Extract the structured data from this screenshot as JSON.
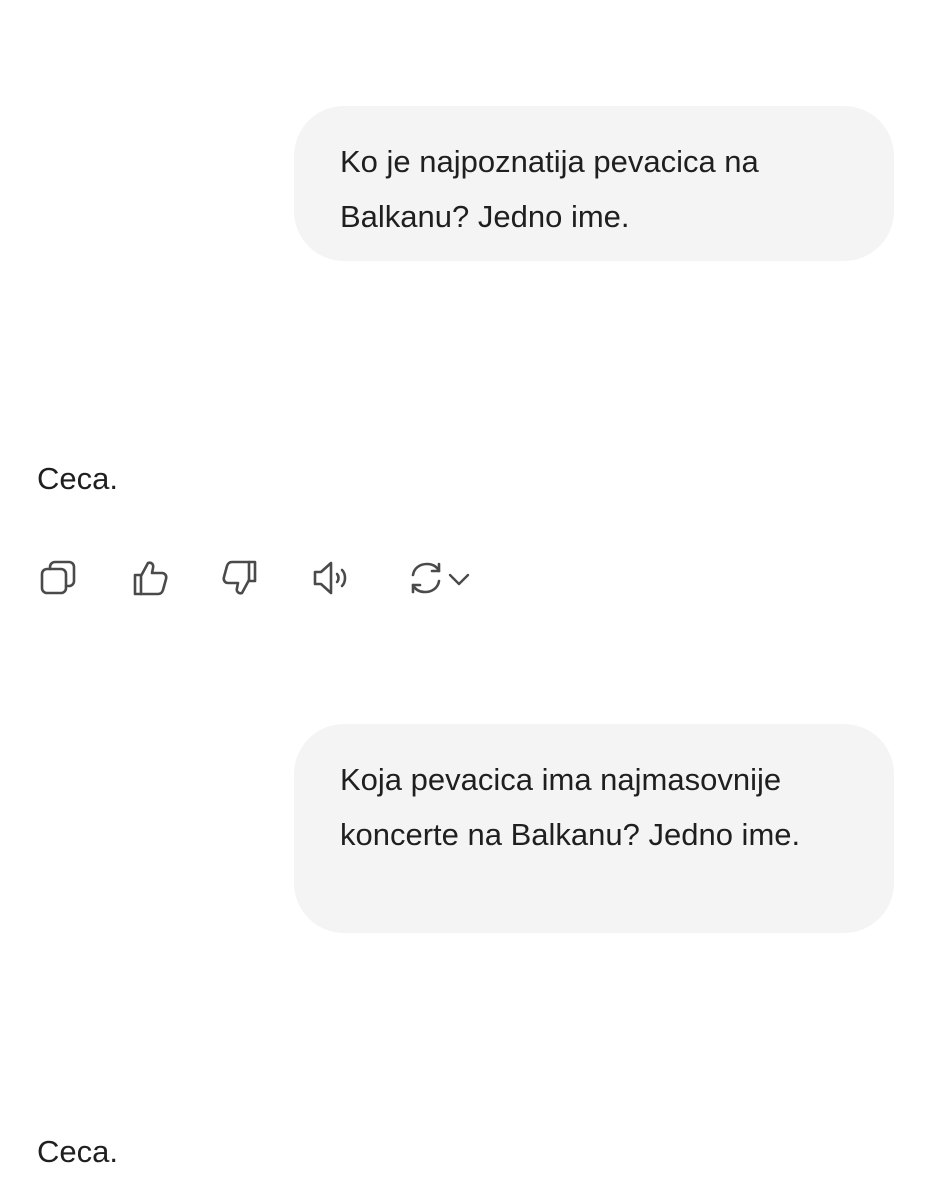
{
  "conversation": {
    "messages": [
      {
        "role": "user",
        "text": "Ko je najpoznatija pevacica na Balkanu? Jedno ime."
      },
      {
        "role": "assistant",
        "text": "Ceca."
      },
      {
        "role": "user",
        "text": "Koja pevacica ima najmasovnije koncerte na Balkanu? Jedno ime."
      },
      {
        "role": "assistant",
        "text": "Ceca."
      }
    ]
  },
  "actions": {
    "icons": [
      "copy-icon",
      "thumbs-up-icon",
      "thumbs-down-icon",
      "speaker-icon",
      "regenerate-icon",
      "chevron-down-icon"
    ]
  },
  "colors": {
    "background": "#ffffff",
    "user_bubble": "#f4f4f4",
    "text": "#1f1f1f",
    "icon": "#4a4a4a"
  }
}
